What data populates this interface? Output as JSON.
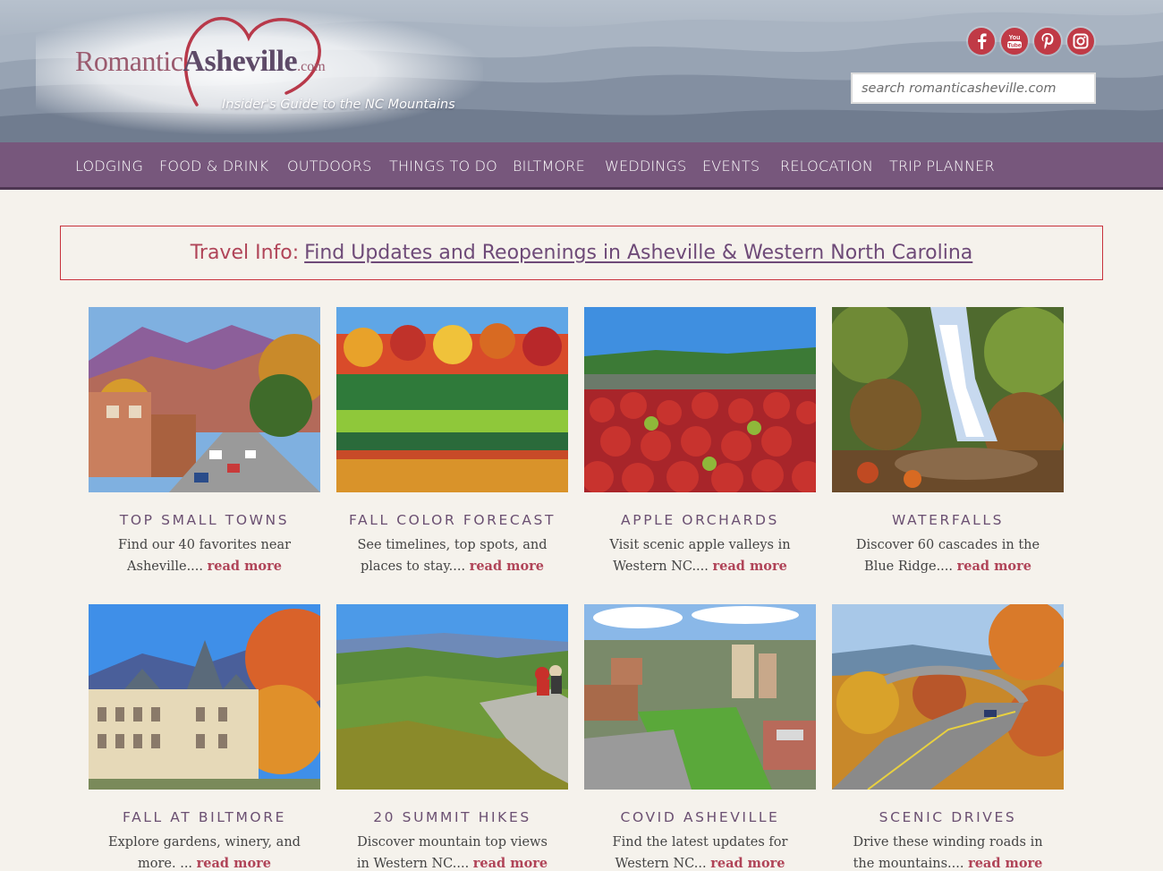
{
  "header": {
    "logo": {
      "word1": "Romantic",
      "word2": "Asheville",
      "word3": ".com"
    },
    "tagline": "Insider's Guide to the NC Mountains",
    "social": [
      {
        "icon": "facebook-icon"
      },
      {
        "icon": "youtube-icon",
        "label": "You Tube"
      },
      {
        "icon": "pinterest-icon"
      },
      {
        "icon": "instagram-icon"
      }
    ],
    "search": {
      "placeholder": "search romanticasheville.com",
      "value": ""
    }
  },
  "nav": {
    "items": [
      "LODGING",
      "FOOD & DRINK",
      "OUTDOORS",
      "THINGS TO DO",
      "BILTMORE",
      "WEDDINGS",
      "EVENTS",
      "RELOCATION",
      "TRIP PLANNER"
    ]
  },
  "banner": {
    "prefix": "Travel Info:",
    "link": "Find Updates and Reopenings in Asheville & Western North Carolina"
  },
  "cards": [
    {
      "title": "TOP SMALL TOWNS",
      "desc": "Find our 40 favorites near Asheville....",
      "more": "read more"
    },
    {
      "title": "FALL COLOR FORECAST",
      "desc": "See timelines, top spots, and places to stay....",
      "more": "read more"
    },
    {
      "title": "APPLE ORCHARDS",
      "desc": "Visit scenic apple valleys in Western NC....",
      "more": "read more"
    },
    {
      "title": "WATERFALLS",
      "desc": "Discover 60 cascades in the Blue Ridge....",
      "more": "read more"
    },
    {
      "title": "FALL AT BILTMORE",
      "desc": "Explore gardens, winery, and more. ...",
      "more": "read more"
    },
    {
      "title": "20 SUMMIT HIKES",
      "desc": "Discover mountain top views in Western NC....",
      "more": "read more"
    },
    {
      "title": "COVID ASHEVILLE",
      "desc": "Find the latest updates for Western NC...",
      "more": "read more"
    },
    {
      "title": "SCENIC DRIVES",
      "desc": "Drive these winding roads in the mountains....",
      "more": "read more"
    }
  ],
  "colors": {
    "nav": "#77577c",
    "accent": "#b04458",
    "title": "#6b5072",
    "banner_border": "#c8323c",
    "page_bg": "#f5f2ec"
  }
}
